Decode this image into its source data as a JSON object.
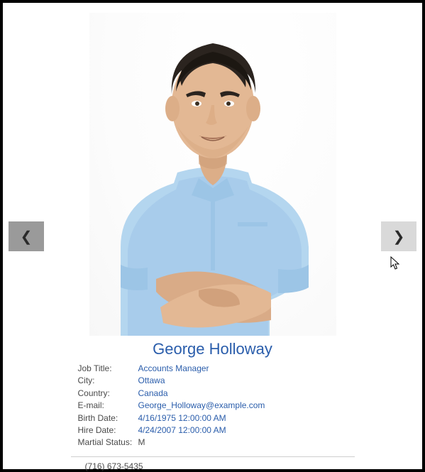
{
  "nav": {
    "prev_glyph": "❮",
    "next_glyph": "❯"
  },
  "person": {
    "name": "George Holloway",
    "fields": [
      {
        "label": "Job Title:",
        "value": "Accounts Manager",
        "link": true
      },
      {
        "label": "City:",
        "value": "Ottawa",
        "link": true
      },
      {
        "label": "Country:",
        "value": "Canada",
        "link": true
      },
      {
        "label": "E-mail:",
        "value": "George_Holloway@example.com",
        "link": true
      },
      {
        "label": "Birth Date:",
        "value": "4/16/1975 12:00:00 AM",
        "link": true
      },
      {
        "label": "Hire Date:",
        "value": "4/24/2007 12:00:00 AM",
        "link": true
      },
      {
        "label": "Martial Status:",
        "value": "M",
        "link": false
      }
    ],
    "phone": "(716) 673-5435"
  }
}
